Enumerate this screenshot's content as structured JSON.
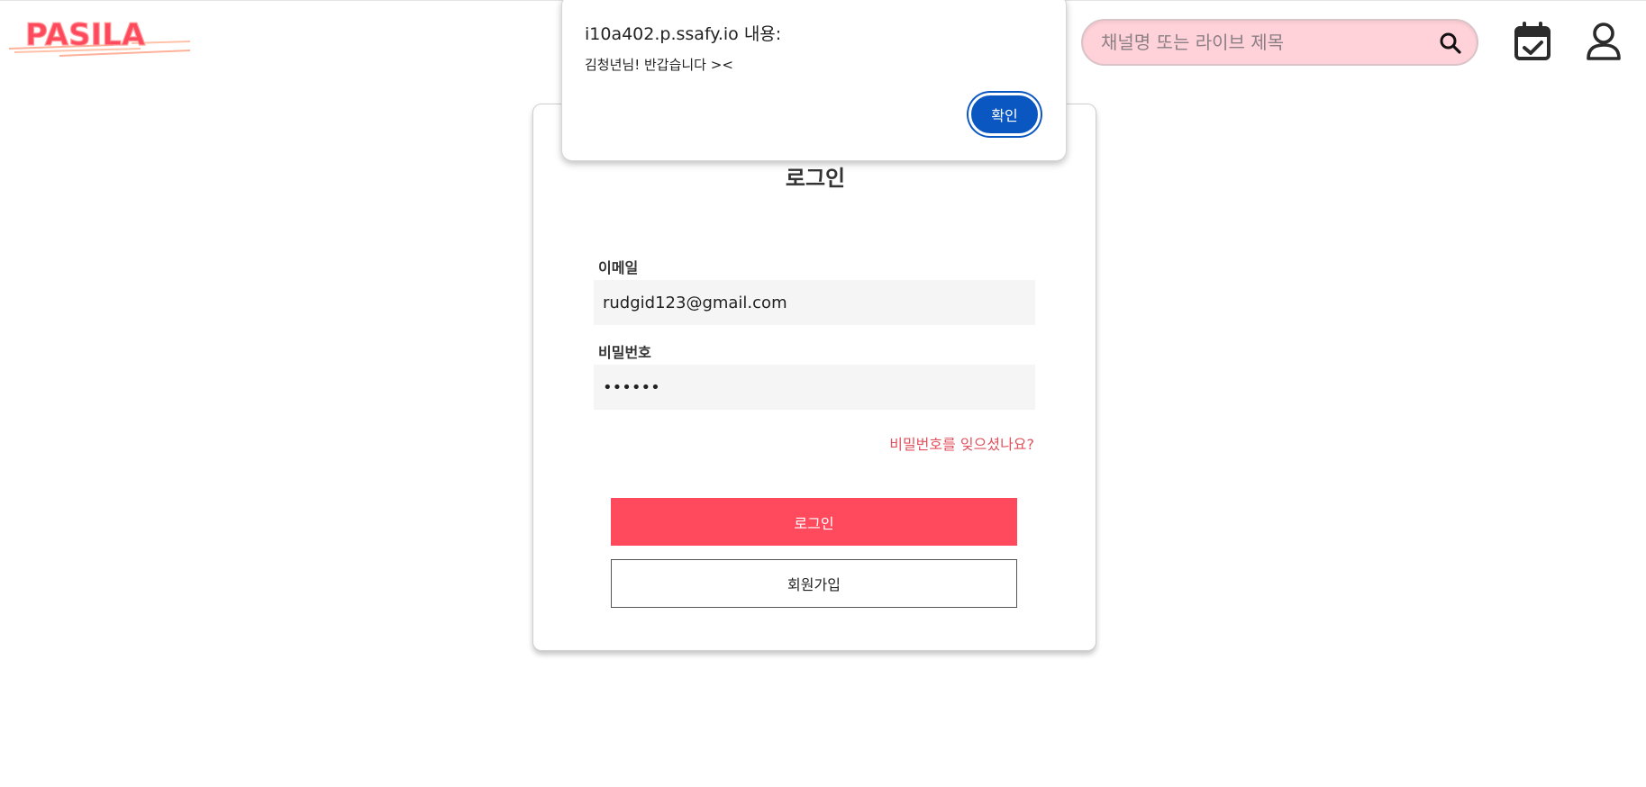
{
  "header": {
    "logo_text": "PASILA",
    "search_placeholder": "채널명 또는 라이브 제목",
    "icons": [
      "search-icon",
      "calendar-check-icon",
      "user-icon"
    ]
  },
  "login": {
    "title": "로그인",
    "email_label": "이메일",
    "email_value": "rudgid123@gmail.com",
    "password_label": "비밀번호",
    "password_value": "••••••",
    "forgot_link": "비밀번호를 잊으셨나요?",
    "login_button": "로그인",
    "signup_button": "회원가입"
  },
  "dialog": {
    "title": "i10a402.p.ssafy.io 내용:",
    "message": "김청년님! 반갑습니다 ><",
    "ok_button": "확인"
  },
  "colors": {
    "accent": "#ff4a5d",
    "search_bg": "#ffd1d8",
    "link": "#e0525e",
    "dialog_button": "#0b57c1"
  }
}
